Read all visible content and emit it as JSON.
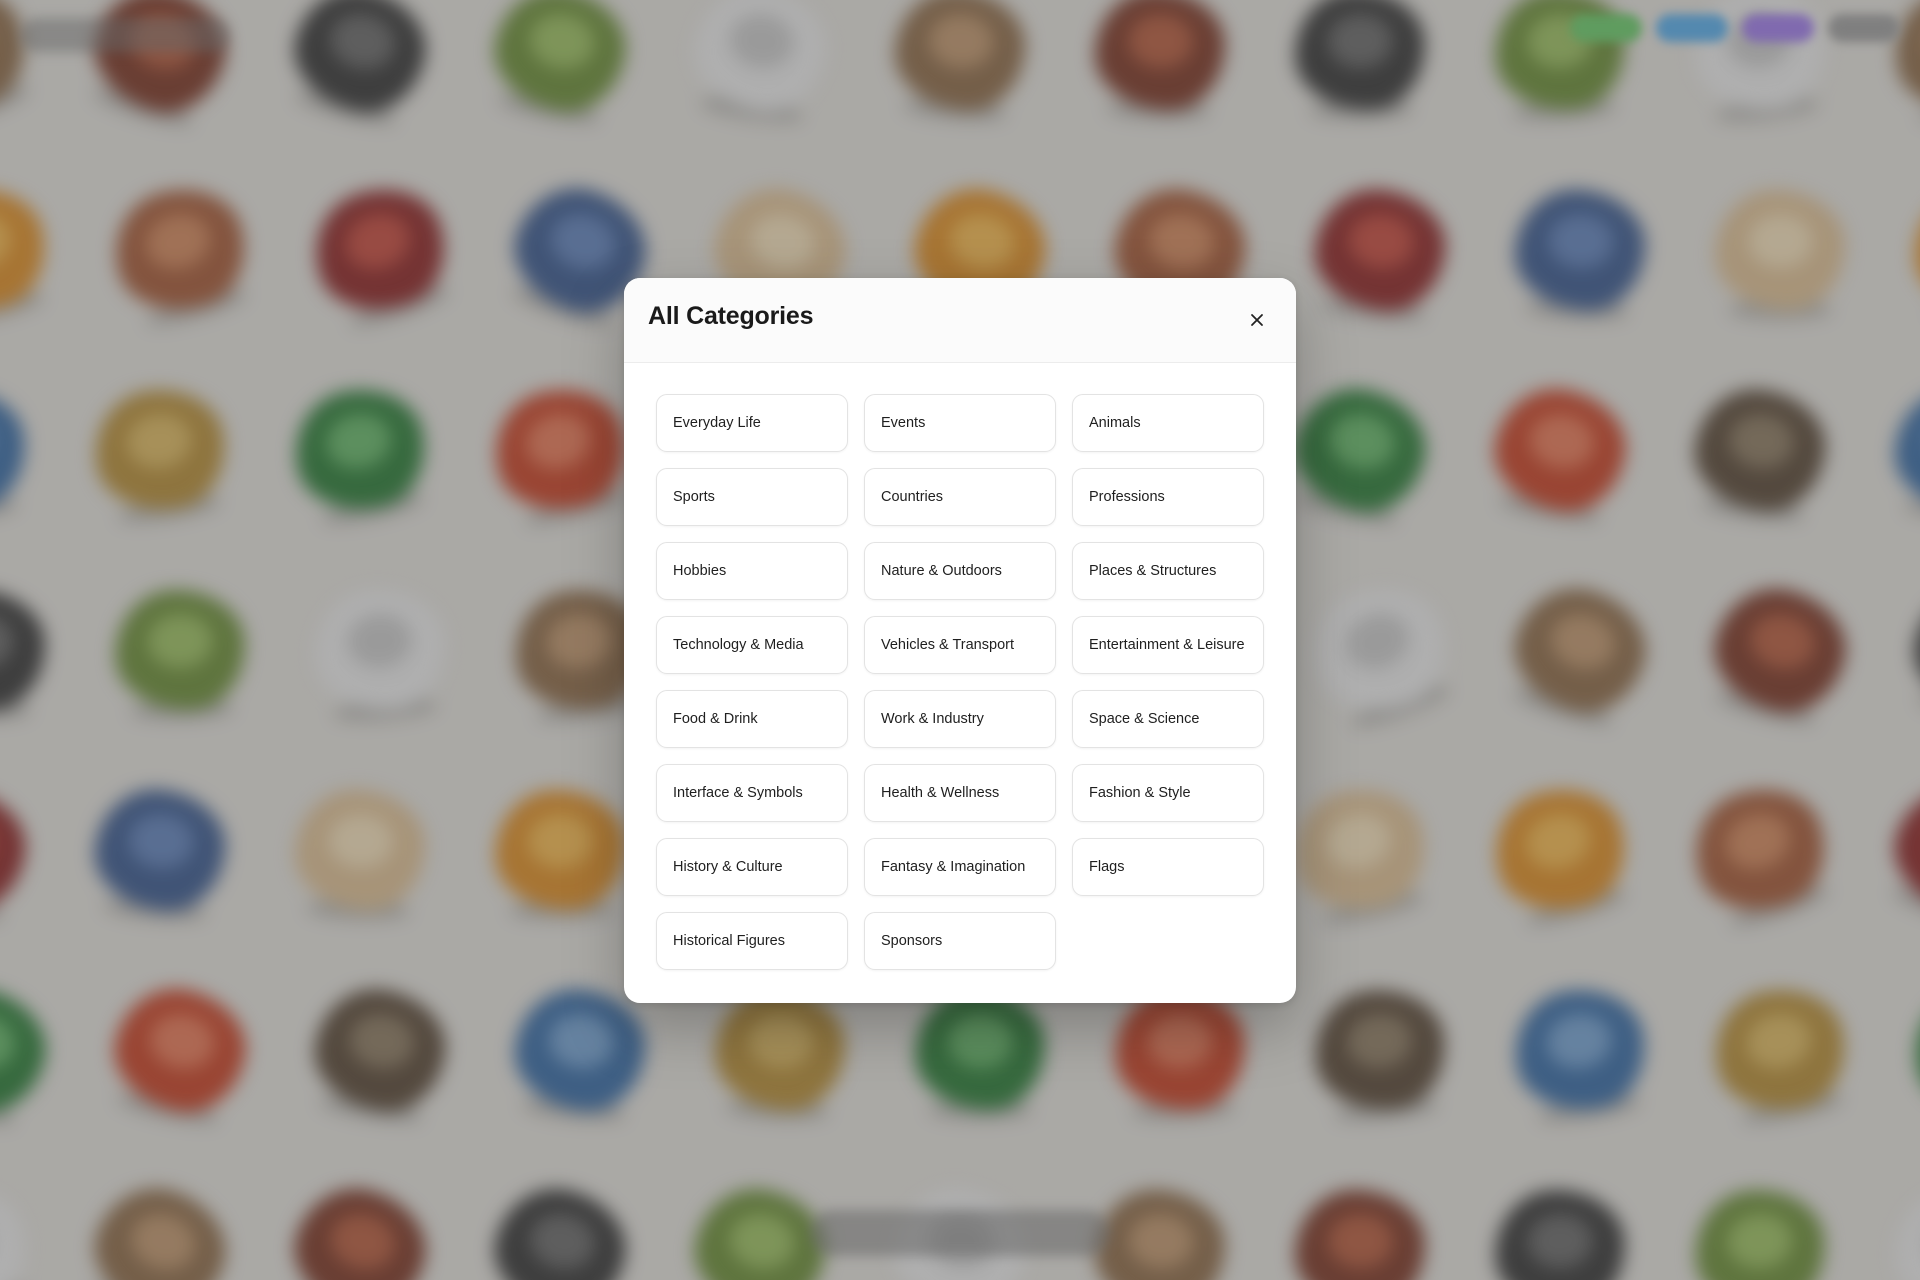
{
  "modal": {
    "title": "All Categories",
    "close_icon": "close-icon",
    "categories": [
      "Everyday Life",
      "Events",
      "Animals",
      "Sports",
      "Countries",
      "Professions",
      "Hobbies",
      "Nature & Outdoors",
      "Places & Structures",
      "Technology & Media",
      "Vehicles & Transport",
      "Entertainment & Leisure",
      "Food & Drink",
      "Work & Industry",
      "Space & Science",
      "Interface & Symbols",
      "Health & Wellness",
      "Fashion & Style",
      "History & Culture",
      "Fantasy & Imagination",
      "Flags",
      "Historical Figures",
      "Sponsors"
    ]
  },
  "colors": {
    "overlay": "#464646",
    "modal_background": "#ffffff",
    "button_border": "#e3e3e3",
    "text": "#1a1a1a"
  }
}
